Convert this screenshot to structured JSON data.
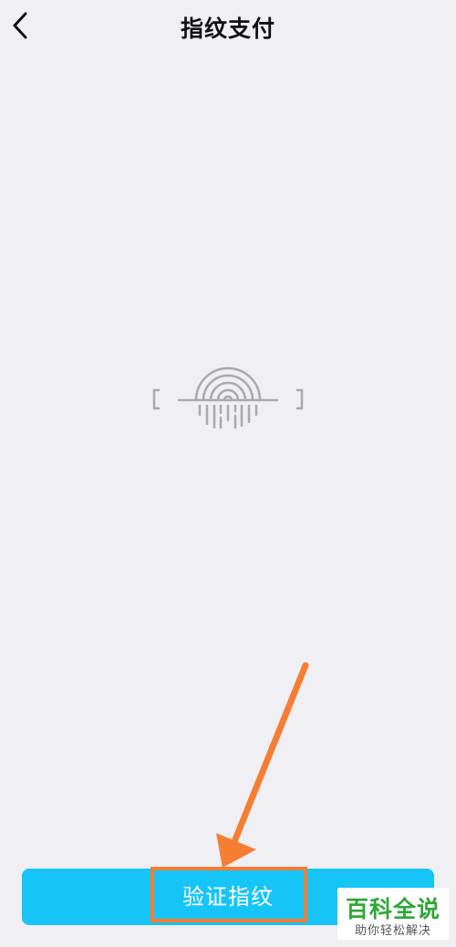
{
  "header": {
    "title": "指纹支付",
    "back_icon": "chevron-left-icon"
  },
  "fingerprint": {
    "icon": "fingerprint-icon",
    "color": "#a9a9ae"
  },
  "action": {
    "verify_label": "验证指纹",
    "button_color": "#17c4f7"
  },
  "annotation": {
    "highlight_color": "#f57e32",
    "arrow_icon": "arrow-icon"
  },
  "watermark": {
    "title": "百科全说",
    "subtitle": "助你轻松解决"
  }
}
